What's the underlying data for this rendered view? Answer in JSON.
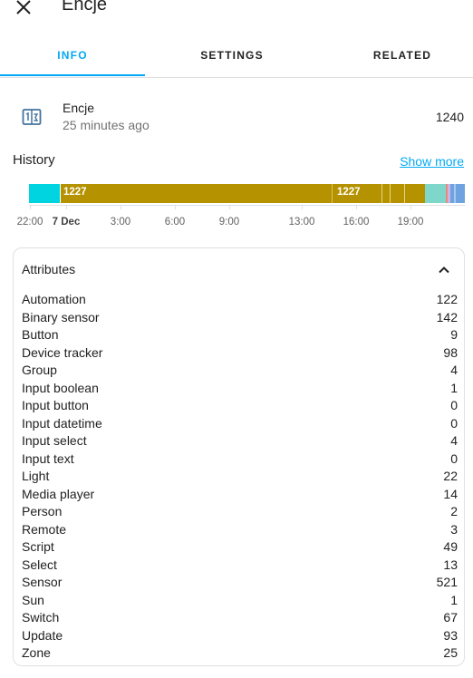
{
  "header": {
    "title": "Encje",
    "close_icon": "close-icon"
  },
  "tabs": [
    {
      "label": "INFO",
      "active": true
    },
    {
      "label": "SETTINGS",
      "active": false
    },
    {
      "label": "RELATED",
      "active": false
    }
  ],
  "entity": {
    "icon": "counter-icon",
    "name": "Encje",
    "last_changed": "25 minutes ago",
    "state": "1240"
  },
  "history": {
    "title": "History",
    "show_more": "Show more",
    "bar_labels": [
      "1227",
      "1227"
    ],
    "ticks": [
      "22:00",
      "7 Dec",
      "3:00",
      "6:00",
      "9:00",
      "13:00",
      "16:00",
      "19:00"
    ],
    "colors": {
      "cyan": "#00d4e0",
      "gold": "#b59200",
      "teal": "#7fd6cb",
      "salmon": "#e98a7a",
      "blue": "#6ea3e0"
    }
  },
  "attributes": {
    "title": "Attributes",
    "items": [
      {
        "key": "Automation",
        "value": "122"
      },
      {
        "key": "Binary sensor",
        "value": "142"
      },
      {
        "key": "Button",
        "value": "9"
      },
      {
        "key": "Device tracker",
        "value": "98"
      },
      {
        "key": "Group",
        "value": "4"
      },
      {
        "key": "Input boolean",
        "value": "1"
      },
      {
        "key": "Input button",
        "value": "0"
      },
      {
        "key": "Input datetime",
        "value": "0"
      },
      {
        "key": "Input select",
        "value": "4"
      },
      {
        "key": "Input text",
        "value": "0"
      },
      {
        "key": "Light",
        "value": "22"
      },
      {
        "key": "Media player",
        "value": "14"
      },
      {
        "key": "Person",
        "value": "2"
      },
      {
        "key": "Remote",
        "value": "3"
      },
      {
        "key": "Script",
        "value": "49"
      },
      {
        "key": "Select",
        "value": "13"
      },
      {
        "key": "Sensor",
        "value": "521"
      },
      {
        "key": "Sun",
        "value": "1"
      },
      {
        "key": "Switch",
        "value": "67"
      },
      {
        "key": "Update",
        "value": "93"
      },
      {
        "key": "Zone",
        "value": "25"
      }
    ]
  }
}
